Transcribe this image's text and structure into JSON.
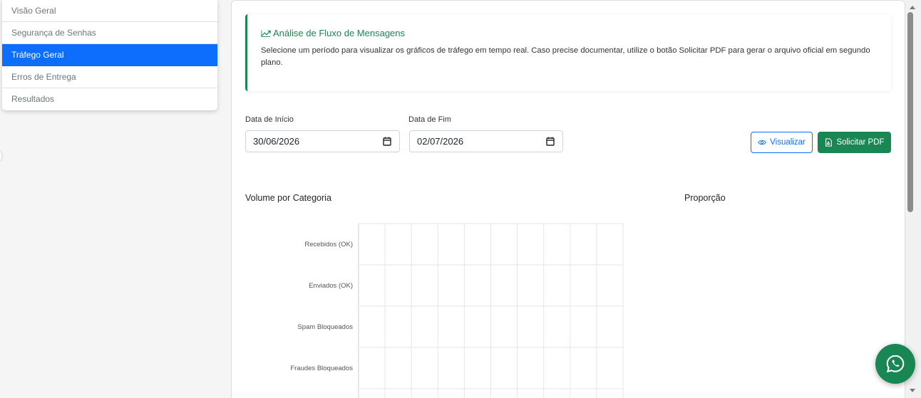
{
  "sidebar": {
    "items": [
      {
        "label": "Visão Geral",
        "active": false
      },
      {
        "label": "Segurança de Senhas",
        "active": false
      },
      {
        "label": "Tráfego Geral",
        "active": true
      },
      {
        "label": "Erros de Entrega",
        "active": false
      },
      {
        "label": "Resultados",
        "active": false
      }
    ]
  },
  "info": {
    "icon": "trending-up-icon",
    "title": "Análise de Fluxo de Mensagens",
    "description": "Selecione um período para visualizar os gráficos de tráfego em tempo real. Caso precise documentar, utilize o botão Solicitar PDF para gerar o arquivo oficial em segundo plano."
  },
  "filters": {
    "start": {
      "label": "Data de Início",
      "value": "30/06/2026"
    },
    "end": {
      "label": "Data de Fim",
      "value": "02/07/2026"
    }
  },
  "actions": {
    "view_label": "Visualizar",
    "pdf_label": "Solicitar PDF"
  },
  "sections": {
    "volume_title": "Volume por Categoria",
    "proportion_title": "Proporção"
  },
  "chart_data": {
    "type": "bar",
    "orientation": "horizontal",
    "categories": [
      "Recebidos (OK)",
      "Enviados (OK)",
      "Spam Bloqueados",
      "Fraudes Bloqueados"
    ],
    "values": [],
    "grid": true
  },
  "colors": {
    "primary": "#0d6efd",
    "success": "#198754"
  }
}
